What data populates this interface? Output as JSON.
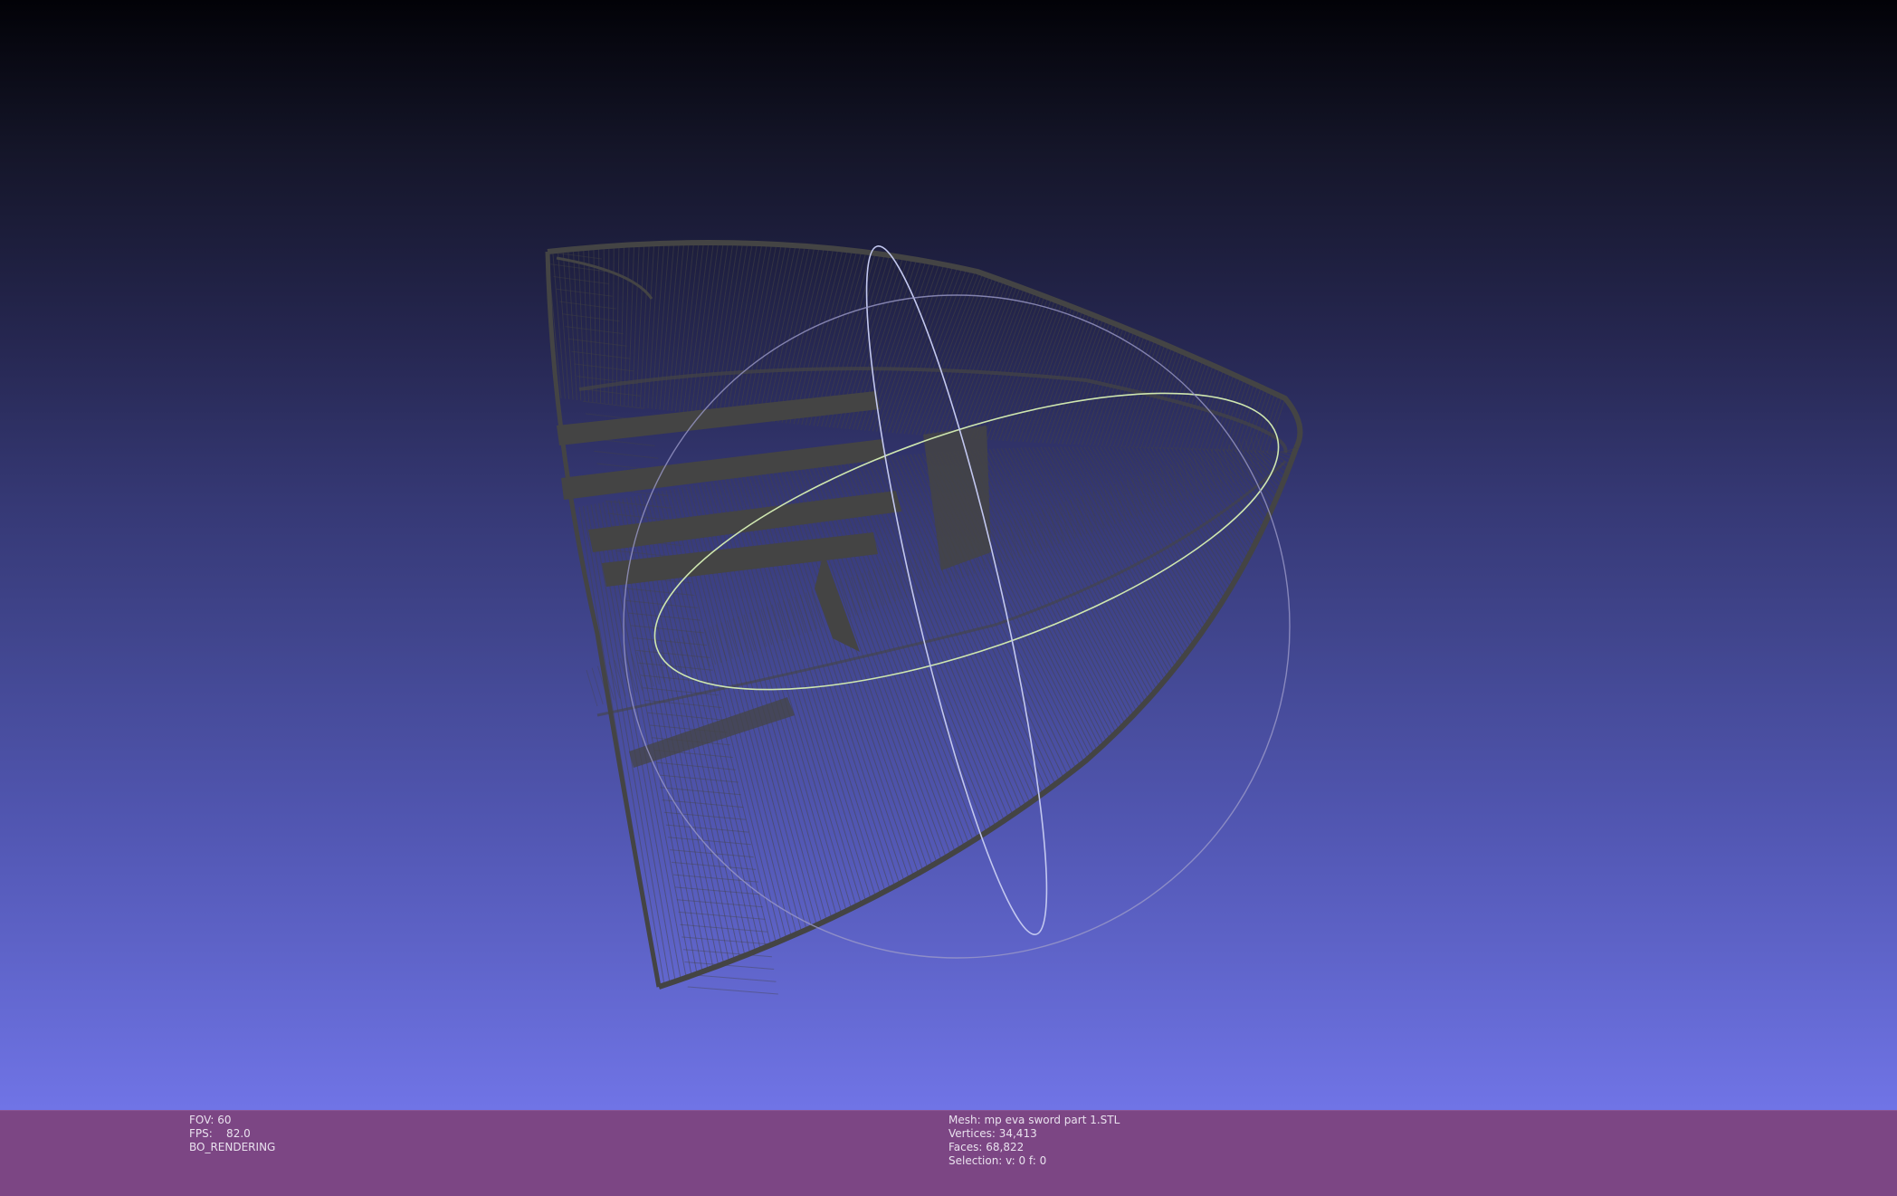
{
  "viewer": {
    "mesh_style": "wireframe",
    "colors": {
      "background_top": "#020207",
      "background_bottom": "#7074e6",
      "mesh": "#444444",
      "info_bar": "#7c4684",
      "info_text": "#e9e1ee",
      "trackball_x": "#c3c8f0",
      "trackball_y": "#cfe7b0",
      "trackball_z": "#9a98c8"
    }
  },
  "info": {
    "fov": "FOV: 60",
    "fps": "FPS:    82.0",
    "render_mode": "BO_RENDERING",
    "mesh_name": "Mesh: mp eva sword part 1.STL",
    "vertices": "Vertices: 34,413",
    "faces": "Faces: 68,822",
    "selection": "Selection: v: 0 f: 0"
  }
}
